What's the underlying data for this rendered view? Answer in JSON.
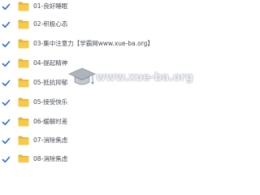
{
  "files": [
    {
      "name": "01-良好睡眠"
    },
    {
      "name": "02-积极心态"
    },
    {
      "name": "03-集中注意力【学霸网www.xue-ba.org】"
    },
    {
      "name": "04-提起精神"
    },
    {
      "name": "05-抵抗抑郁"
    },
    {
      "name": "05-接受快乐"
    },
    {
      "name": "06-缓解时差"
    },
    {
      "name": "07-消除焦虑"
    },
    {
      "name": "08-消除焦虑"
    }
  ],
  "watermark": {
    "text": "www.xue-ba.org"
  },
  "icons": {
    "checkbox": "checkbox-checked-icon",
    "folder": "folder-icon",
    "watermark": "graduation-cap-icon"
  },
  "colors": {
    "folder": "#f7c948",
    "folder_back": "#e9b236",
    "check": "#2d6bd6",
    "text": "#444a52"
  }
}
